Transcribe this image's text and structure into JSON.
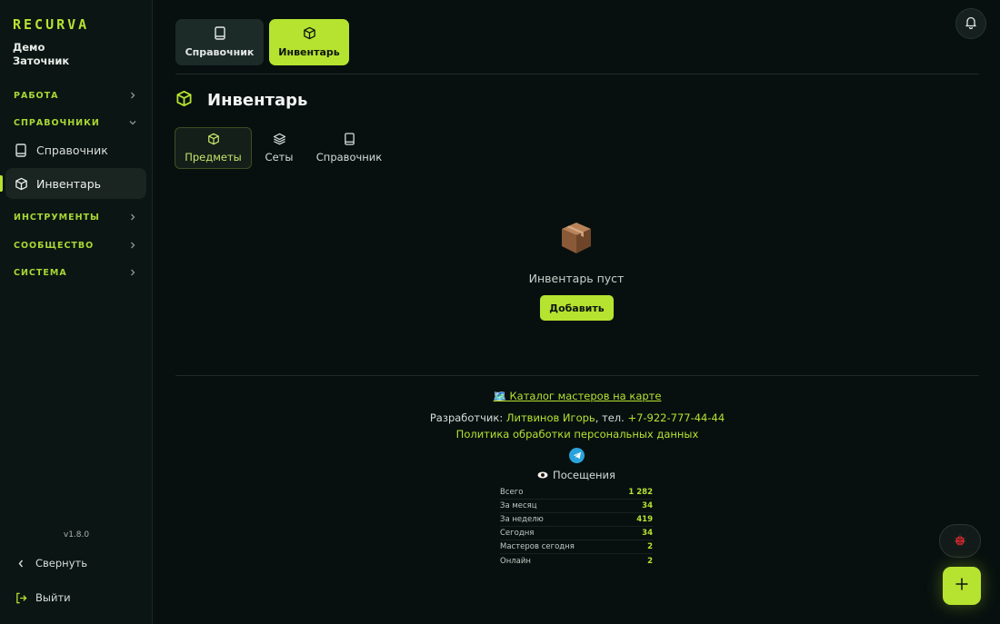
{
  "app": {
    "logo": "RECURVA",
    "user_line1": "Демо",
    "user_line2": "Заточник",
    "version": "v1.8.0"
  },
  "sidebar": {
    "sections": [
      {
        "label": "РАБОТА",
        "expanded": false
      },
      {
        "label": "СПРАВОЧНИКИ",
        "expanded": true
      },
      {
        "label": "ИНСТРУМЕНТЫ",
        "expanded": false
      },
      {
        "label": "СООБЩЕСТВО",
        "expanded": false
      },
      {
        "label": "СИСТЕМА",
        "expanded": false
      }
    ],
    "items": [
      {
        "label": "Справочник",
        "icon": "book-icon",
        "active": false
      },
      {
        "label": "Инвентарь",
        "icon": "box-icon",
        "active": true
      }
    ],
    "collapse_label": "Свернуть",
    "logout_label": "Выйти"
  },
  "top_tabs": [
    {
      "label": "Справочник",
      "icon": "book-icon",
      "active": false
    },
    {
      "label": "Инвентарь",
      "icon": "box-icon",
      "active": true
    }
  ],
  "page": {
    "title": "Инвентарь",
    "title_icon": "box-icon"
  },
  "sub_tabs": [
    {
      "label": "Предметы",
      "icon": "box-icon",
      "active": true
    },
    {
      "label": "Сеты",
      "icon": "layers-icon",
      "active": false
    },
    {
      "label": "Справочник",
      "icon": "book-icon",
      "active": false
    }
  ],
  "empty_state": {
    "icon": "package-emoji",
    "text": "Инвентарь пуст",
    "add_label": "Добавить"
  },
  "footer": {
    "catalog_link": "🗺️ Каталог мастеров на карте",
    "dev_prefix": "Разработчик: ",
    "dev_name": "Литвинов Игорь",
    "dev_middle": ", тел. ",
    "dev_phone": "+7-922-777-44-44",
    "privacy_link": "Политика обработки персональных данных",
    "visits_title": "Посещения",
    "stats": [
      {
        "label": "Всего",
        "value": "1 282"
      },
      {
        "label": "За месяц",
        "value": "34"
      },
      {
        "label": "За неделю",
        "value": "419"
      },
      {
        "label": "Сегодня",
        "value": "34"
      },
      {
        "label": "Мастеров сегодня",
        "value": "2"
      },
      {
        "label": "Онлайн",
        "value": "2"
      }
    ]
  },
  "colors": {
    "accent": "#b6e330",
    "background": "#07100f",
    "sidebar": "#0b1513"
  }
}
